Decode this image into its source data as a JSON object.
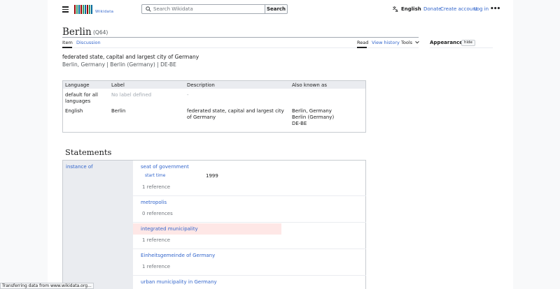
{
  "header": {
    "logo_text": "Wikidata",
    "logo_colors": [
      "#990000",
      "#339966",
      "#006699",
      "#990000",
      "#339966",
      "#006699",
      "#990000",
      "#339966",
      "#006699"
    ],
    "search_placeholder": "Search Wikidata",
    "search_button": "Search",
    "language": "English",
    "links": [
      "Donate",
      "Create account",
      "Log in"
    ],
    "more": "•••"
  },
  "page": {
    "title": "Berlin",
    "qid": "(Q64)",
    "tabs_left": [
      "Item",
      "Discussion"
    ],
    "tabs_right": [
      "Read",
      "View history",
      "Tools"
    ],
    "appearance": "Appearance",
    "hide": "hide",
    "description": "federated state, capital and largest city of Germany",
    "aliases": "Berlin, Germany | Berlin (Germany) | DE-BE"
  },
  "terms": {
    "headers": [
      "Language",
      "Label",
      "Description",
      "Also known as"
    ],
    "rows": [
      {
        "language": "default for all languages",
        "label": "No label defined",
        "description": "-",
        "aka": []
      },
      {
        "language": "English",
        "label": "Berlin",
        "description": "federated state, capital and largest city of Germany",
        "aka": [
          "Berlin, Germany",
          "Berlin (Germany)",
          "DE-BE"
        ]
      }
    ]
  },
  "statements": {
    "heading": "Statements",
    "property": "instance of",
    "values": [
      {
        "label": "seat of government",
        "qualifier_prop": "start time",
        "qualifier_val": "1999",
        "refs": "1 reference"
      },
      {
        "label": "metropolis",
        "refs": "0 references"
      },
      {
        "label": "integrated municipality",
        "refs": "1 reference"
      },
      {
        "label": "Einheitsgemeinde of Germany",
        "refs": "1 reference"
      },
      {
        "label": "urban municipality in Germany"
      }
    ]
  },
  "status_bar": "Transferring data from www.wikidata.org..."
}
